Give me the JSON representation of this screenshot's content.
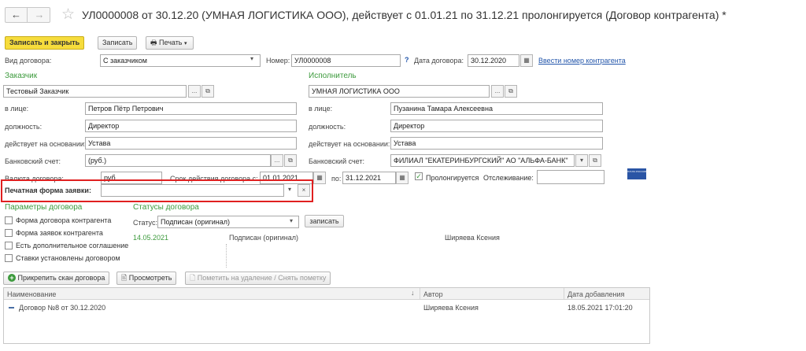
{
  "title": "УЛ0000008 от 30.12.20 (УМНАЯ ЛОГИСТИКА ООО), действует с 01.01.21 по 31.12.21 пролонгируется (Договор контрагента) *",
  "toolbar": {
    "save_close": "Записать и закрыть",
    "save": "Записать",
    "print": "Печать"
  },
  "form": {
    "vid_label": "Вид договора:",
    "vid_value": "С заказчиком",
    "nomer_label": "Номер:",
    "nomer_value": "УЛ0000008",
    "help": "?",
    "date_label": "Дата договора:",
    "date_value": "30.12.2020",
    "enter_number_link": "Ввести номер контрагента",
    "customer_header": "Заказчик",
    "customer_value": "Тестовый Заказчик",
    "executor_header": "Исполнитель",
    "executor_value": "УМНАЯ ЛОГИСТИКА ООО",
    "in_person_label": "в лице:",
    "customer_person": "Петров Пётр Петрович",
    "executor_person": "Пузанина Тамара Алексеевна",
    "position_label": "должность:",
    "customer_position": "Директор",
    "executor_position": "Директор",
    "basis_label": "действует на основании:",
    "customer_basis": "Устава",
    "executor_basis": "Устава",
    "bank_label": "Банковский счет:",
    "customer_bank": "(руб.)",
    "executor_bank": "ФИЛИАЛ \"ЕКАТЕРИНБУРГСКИЙ\" АО \"АЛЬФА-БАНК\"",
    "currency_label": "Валюта договора:",
    "currency_value": "руб.",
    "term_label": "Срок действия договора с:",
    "term_from": "01.01.2021",
    "to_label": "по:",
    "term_to": "31.12.2021",
    "prolong_label": "Пролонгируется",
    "tracking_label": "Отслеживание:",
    "mail_logo": "ПОЧТА РОССИИ",
    "print_form_label": "Печатная форма заявки:"
  },
  "params": {
    "header": "Параметры договора",
    "items": [
      "Форма договора контрагента",
      "Форма заявок контрагента",
      "Есть дополнительное соглашение",
      "Ставки установлены договором"
    ]
  },
  "statuses": {
    "header": "Статусы договора",
    "status_label": "Статус:",
    "status_value": "Подписан (оригинал)",
    "save_button": "записать",
    "row_date": "14.05.2021",
    "row_status": "Подписан (оригинал)",
    "row_author": "Ширяева Ксения"
  },
  "files": {
    "attach": "Прикрепить скан договора",
    "view": "Просмотреть",
    "mark_delete": "Пометить на удаление / Снять пометку",
    "columns": [
      "Наименование",
      "Автор",
      "Дата добавления"
    ],
    "rows": [
      {
        "name": "Договор №8 от 30.12.2020",
        "author": "Ширяева Ксения",
        "date": "18.05.2021 17:01:20"
      }
    ]
  },
  "colors": {
    "accent_yellow": "#f6dc3c",
    "green": "#3c9a3c",
    "highlight_red": "#e02020",
    "link": "#2255aa"
  }
}
